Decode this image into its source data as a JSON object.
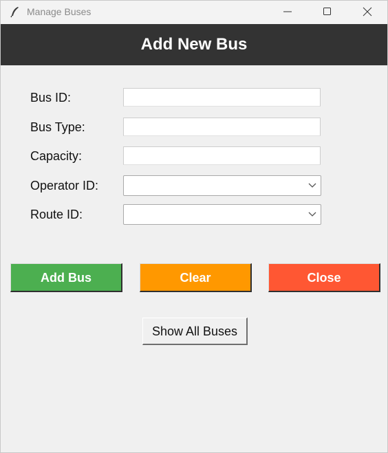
{
  "window": {
    "title": "Manage Buses"
  },
  "header": {
    "title": "Add New Bus"
  },
  "form": {
    "bus_id": {
      "label": "Bus ID:",
      "value": ""
    },
    "bus_type": {
      "label": "Bus Type:",
      "value": ""
    },
    "capacity": {
      "label": "Capacity:",
      "value": ""
    },
    "operator_id": {
      "label": "Operator ID:",
      "selected": ""
    },
    "route_id": {
      "label": "Route ID:",
      "selected": ""
    }
  },
  "buttons": {
    "add": {
      "label": "Add Bus",
      "color": "#4caf50"
    },
    "clear": {
      "label": "Clear",
      "color": "#ff9800"
    },
    "close": {
      "label": "Close",
      "color": "#ff5733"
    },
    "show_all": {
      "label": "Show All Buses"
    }
  },
  "icons": {
    "app": "feather-icon",
    "minimize": "minimize-icon",
    "maximize": "maximize-icon",
    "close": "close-icon",
    "dropdown": "chevron-down-icon"
  },
  "colors": {
    "header_bg": "#333333",
    "window_bg": "#f0f0f0"
  }
}
